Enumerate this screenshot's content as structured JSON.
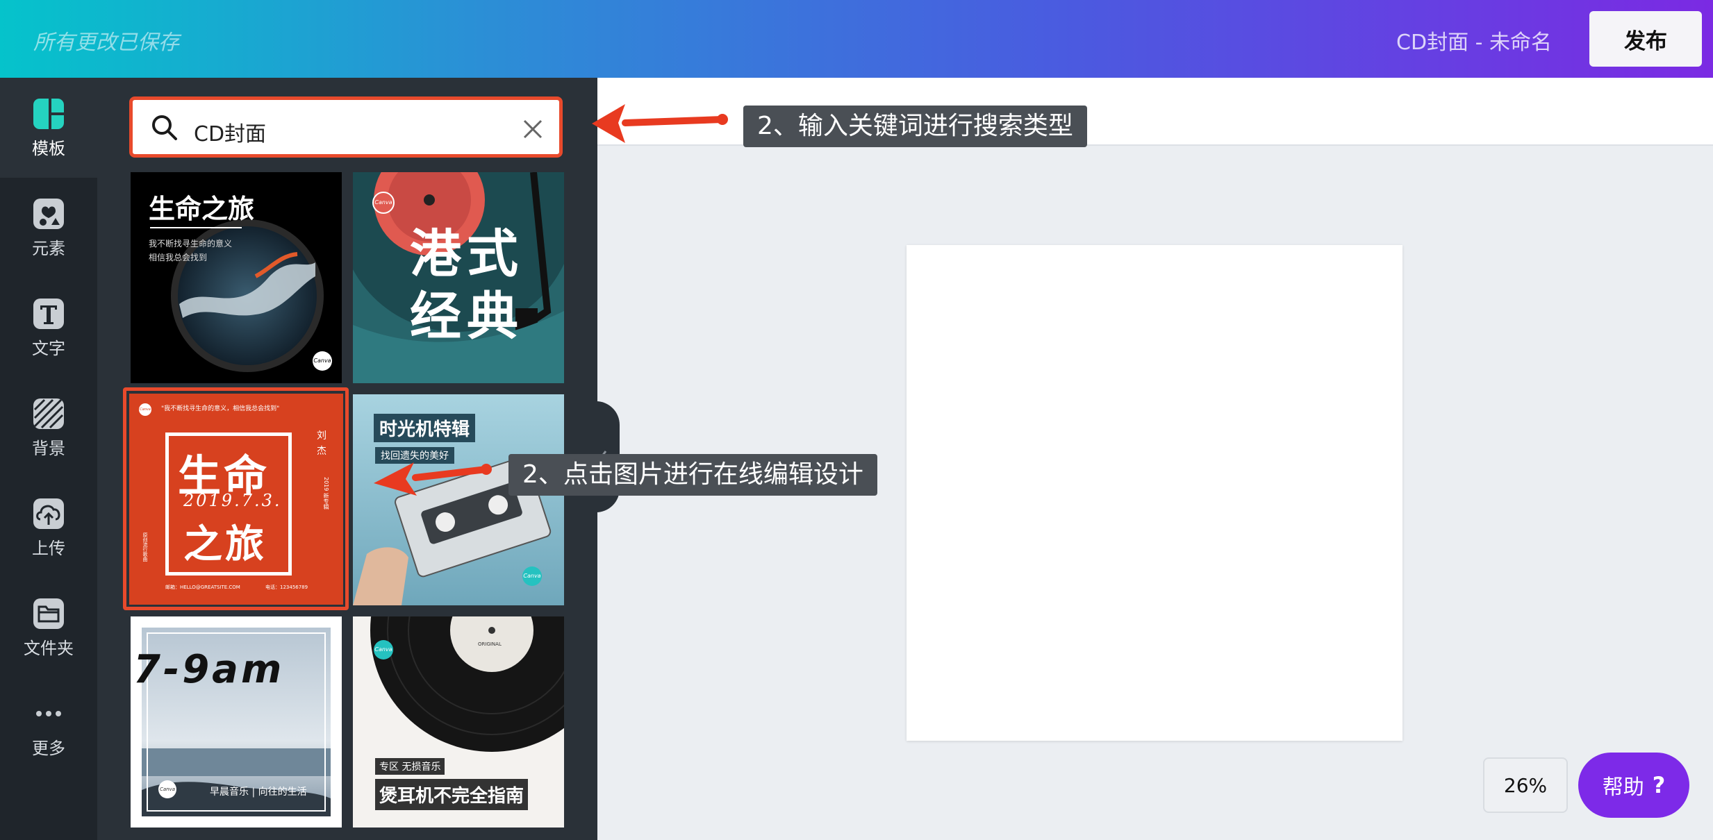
{
  "header": {
    "save_status": "所有更改已保存",
    "doc_title": "CD封面 - 未命名",
    "publish_label": "发布"
  },
  "sidebar": {
    "items": [
      {
        "label": "模板",
        "icon": "template-icon"
      },
      {
        "label": "元素",
        "icon": "elements-icon"
      },
      {
        "label": "文字",
        "icon": "text-icon"
      },
      {
        "label": "背景",
        "icon": "background-icon"
      },
      {
        "label": "上传",
        "icon": "upload-icon"
      },
      {
        "label": "文件夹",
        "icon": "folder-icon"
      },
      {
        "label": "更多",
        "icon": "more-icon"
      }
    ]
  },
  "search": {
    "value": "CD封面"
  },
  "templates": [
    {
      "title": "生命之旅",
      "line1": "我不断找寻生命的意义",
      "line2": "相信我总会找到",
      "badge": "Canva"
    },
    {
      "title1": "港式",
      "title2": "经典",
      "badge": "Canva"
    },
    {
      "top": "\"我不断找寻生命的意义，相信我总会找到\"",
      "title1": "生命",
      "date": "2019.7.3.",
      "title2": "之旅",
      "side1": "刘",
      "side2": "杰",
      "side3": "2019 新专辑",
      "left_note": "原创流行歌曲",
      "footer_email": "邮箱：HELLO@GREATSITE.COM",
      "footer_phone": "电话：123456789",
      "badge": "Canva"
    },
    {
      "title": "时光机特辑",
      "subtitle": "找回遗失的美好",
      "badge": "Canva"
    },
    {
      "title": "7-9am",
      "caption": "早晨音乐 | 向往的生活",
      "badge": "Canva"
    },
    {
      "tag": "专区  无损音乐",
      "title": "煲耳机不完全指南",
      "label": "ORIGINAL",
      "badge": "Canva"
    }
  ],
  "canvas": {
    "zoom": "26%"
  },
  "help": {
    "label": "帮助",
    "icon": "?"
  },
  "annotations": {
    "search_tip": "2、输入关键词进行搜索类型",
    "click_tip": "2、点击图片进行在线编辑设计"
  },
  "colors": {
    "accent": "#7d2ae8",
    "highlight": "#e84a2c",
    "rail": "#1f252b",
    "panel": "#2a3138"
  }
}
